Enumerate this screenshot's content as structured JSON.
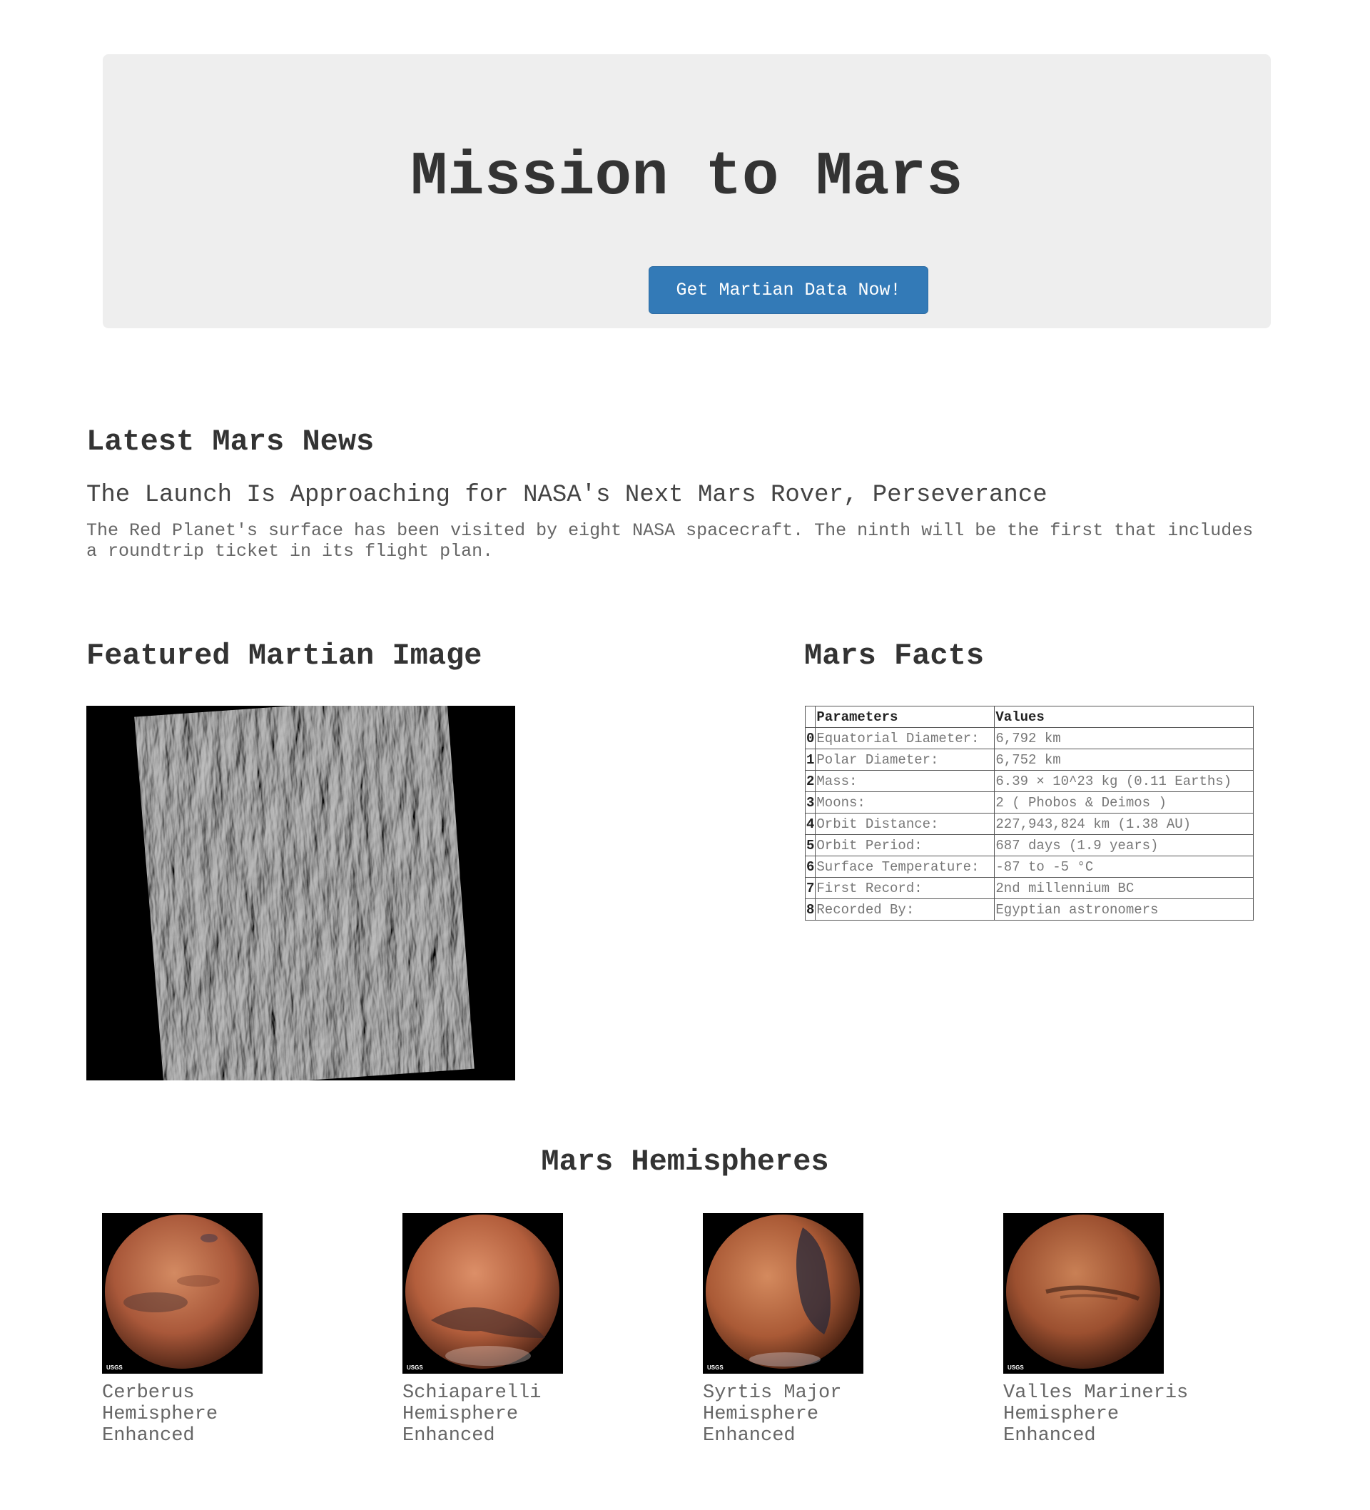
{
  "header": {
    "title": "Mission to Mars",
    "scrape_button": "Get Martian Data Now!"
  },
  "news": {
    "section_title": "Latest Mars News",
    "headline": "The Launch Is Approaching for NASA's Next Mars Rover, Perseverance",
    "teaser": "The Red Planet's surface has been visited by eight NASA spacecraft. The ninth will be the first that includes a roundtrip ticket in its flight plan."
  },
  "featured": {
    "section_title": "Featured Martian Image"
  },
  "facts": {
    "section_title": "Mars Facts",
    "columns": [
      "Parameters",
      "Values"
    ],
    "rows": [
      {
        "index": "0",
        "param": "Equatorial Diameter:",
        "value": "6,792 km"
      },
      {
        "index": "1",
        "param": "Polar Diameter:",
        "value": "6,752 km"
      },
      {
        "index": "2",
        "param": "Mass:",
        "value": "6.39 × 10^23 kg (0.11 Earths)"
      },
      {
        "index": "3",
        "param": "Moons:",
        "value": "2 ( Phobos & Deimos )"
      },
      {
        "index": "4",
        "param": "Orbit Distance:",
        "value": "227,943,824 km (1.38 AU)"
      },
      {
        "index": "5",
        "param": "Orbit Period:",
        "value": "687 days (1.9 years)"
      },
      {
        "index": "6",
        "param": "Surface Temperature:",
        "value": "-87 to -5 °C"
      },
      {
        "index": "7",
        "param": "First Record:",
        "value": "2nd millennium BC"
      },
      {
        "index": "8",
        "param": "Recorded By:",
        "value": "Egyptian astronomers"
      }
    ]
  },
  "hemispheres": {
    "section_title": "Mars Hemispheres",
    "items": [
      {
        "title_line1": "Cerberus",
        "title_line2": "Hemisphere",
        "title_line3": "Enhanced",
        "logo": "USGS"
      },
      {
        "title_line1": "Schiaparelli",
        "title_line2": "Hemisphere",
        "title_line3": "Enhanced",
        "logo": "USGS"
      },
      {
        "title_line1": "Syrtis Major",
        "title_line2": "Hemisphere",
        "title_line3": "Enhanced",
        "logo": "USGS"
      },
      {
        "title_line1": "Valles Marineris",
        "title_line2": "Hemisphere",
        "title_line3": "Enhanced",
        "logo": "USGS"
      }
    ]
  }
}
